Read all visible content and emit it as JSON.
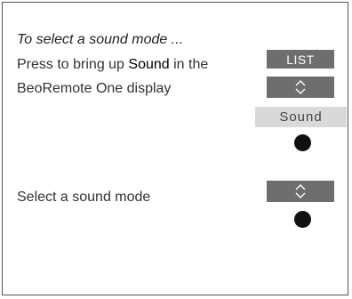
{
  "heading": "To select a sound mode ...",
  "step1": {
    "before": "Press to bring up ",
    "highlight": "Sound",
    "after": " in the",
    "line2": "BeoRemote One display"
  },
  "step2": {
    "text": "Select a sound mode"
  },
  "buttons": {
    "list_label": "LIST",
    "display_label": "Sound",
    "navigate_icon": "up-down-chevron-icon",
    "center_icon": "center-button-dot"
  },
  "colors": {
    "button_bg": "#6e6e6e",
    "display_bg": "#d9d9d9",
    "dot": "#111111"
  }
}
